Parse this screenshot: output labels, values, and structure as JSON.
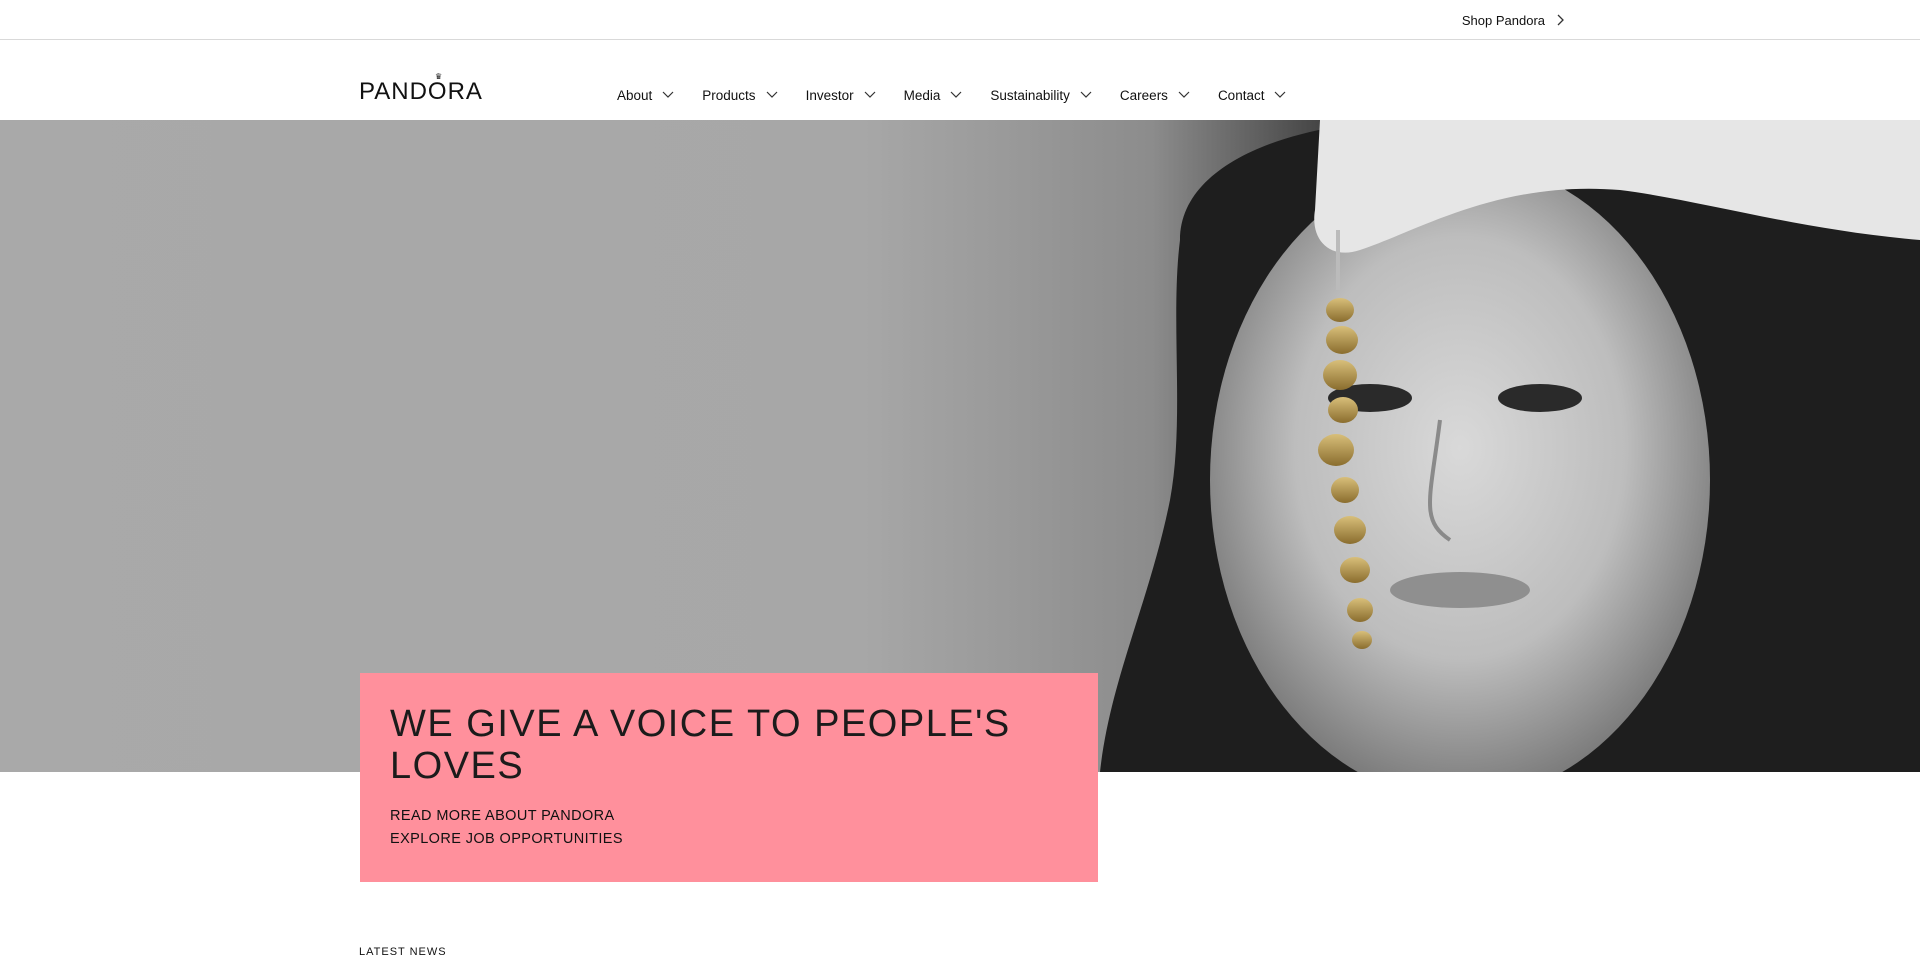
{
  "topbar": {
    "shop_label": "Shop Pandora",
    "shop_icon": "chevron-right-icon"
  },
  "header": {
    "logo_text": "PANDORA",
    "nav": [
      {
        "label": "About",
        "icon": "chevron-down-icon"
      },
      {
        "label": "Products",
        "icon": "chevron-down-icon"
      },
      {
        "label": "Investor",
        "icon": "chevron-down-icon"
      },
      {
        "label": "Media",
        "icon": "chevron-down-icon"
      },
      {
        "label": "Sustainability",
        "icon": "chevron-down-icon"
      },
      {
        "label": "Careers",
        "icon": "chevron-down-icon"
      },
      {
        "label": "Contact",
        "icon": "chevron-down-icon"
      }
    ]
  },
  "hero": {
    "title": "WE GIVE A VOICE TO PEOPLE'S LOVES",
    "links": [
      "READ MORE ABOUT PANDORA",
      "EXPLORE JOB OPPORTUNITIES"
    ]
  },
  "section": {
    "latest_label": "LATEST NEWS"
  },
  "colors": {
    "card_pink": "#ff909c",
    "hero_grey": "#a8a8a8",
    "text": "#111111"
  }
}
